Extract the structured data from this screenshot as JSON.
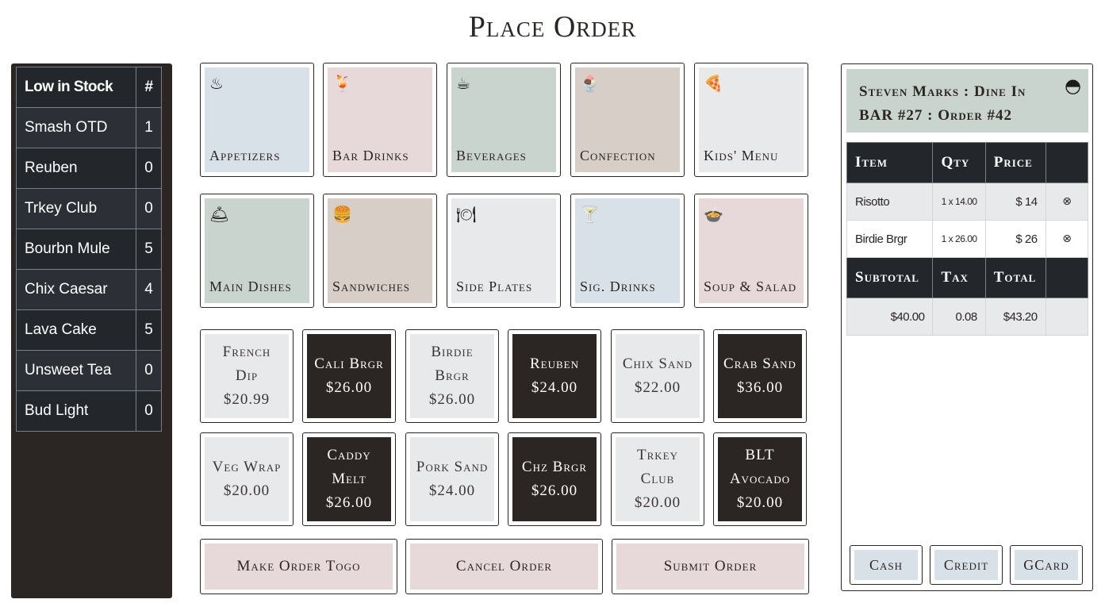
{
  "page": {
    "title": "Place Order"
  },
  "low_stock": {
    "header_name": "Low in Stock",
    "header_count": "#",
    "items": [
      {
        "name": "Smash OTD",
        "count": "1"
      },
      {
        "name": "Reuben",
        "count": "0"
      },
      {
        "name": "Trkey Club",
        "count": "0"
      },
      {
        "name": "Bourbn Mule",
        "count": "5"
      },
      {
        "name": "Chix Caesar",
        "count": "4"
      },
      {
        "name": "Lava Cake",
        "count": "5"
      },
      {
        "name": "Unsweet Tea",
        "count": "0"
      },
      {
        "name": "Bud Light",
        "count": "0"
      }
    ]
  },
  "categories": [
    {
      "label": "Appetizers",
      "icon": "chef-hat-icon",
      "glyph": "♨",
      "bg": "#d9e1e8"
    },
    {
      "label": "Bar Drinks",
      "icon": "cocktail-glass-icon",
      "glyph": "🍹",
      "bg": "#e7d9da"
    },
    {
      "label": "Beverages",
      "icon": "coffee-cup-icon",
      "glyph": "☕",
      "bg": "#c9d4cf"
    },
    {
      "label": "Confection",
      "icon": "sundae-icon",
      "glyph": "🍨",
      "bg": "#d7cec7"
    },
    {
      "label": "Kids' Menu",
      "icon": "pizza-slice-icon",
      "glyph": "🍕",
      "bg": "#e8e9eb"
    },
    {
      "label": "Main Dishes",
      "icon": "cloche-icon",
      "glyph": "🛎",
      "bg": "#c9d4cf"
    },
    {
      "label": "Sandwiches",
      "icon": "burger-icon",
      "glyph": "🍔",
      "bg": "#d7cec7"
    },
    {
      "label": "Side Plates",
      "icon": "plate-utensils-icon",
      "glyph": "🍽",
      "bg": "#e8e9eb"
    },
    {
      "label": "Sig. Drinks",
      "icon": "martini-icon",
      "glyph": "🍸",
      "bg": "#d9e1e8"
    },
    {
      "label": "Soup & Salad",
      "icon": "soup-bowl-icon",
      "glyph": "🍲",
      "bg": "#e7d9da"
    }
  ],
  "menu_items": [
    {
      "name": "French Dip",
      "price": "$20.99",
      "style": "light"
    },
    {
      "name": "Cali Brgr",
      "price": "$26.00",
      "style": "dark"
    },
    {
      "name": "Birdie Brgr",
      "price": "$26.00",
      "style": "light"
    },
    {
      "name": "Reuben",
      "price": "$24.00",
      "style": "dark"
    },
    {
      "name": "Chix Sand",
      "price": "$22.00",
      "style": "light"
    },
    {
      "name": "Crab Sand",
      "price": "$36.00",
      "style": "dark"
    },
    {
      "name": "Veg Wrap",
      "price": "$20.00",
      "style": "light"
    },
    {
      "name": "Caddy Melt",
      "price": "$26.00",
      "style": "dark"
    },
    {
      "name": "Pork Sand",
      "price": "$24.00",
      "style": "light"
    },
    {
      "name": "Chz Brgr",
      "price": "$26.00",
      "style": "dark"
    },
    {
      "name": "Trkey Club",
      "price": "$20.00",
      "style": "light"
    },
    {
      "name": "BLT Avocado",
      "price": "$20.00",
      "style": "dark"
    }
  ],
  "actions": {
    "togo": "Make Order Togo",
    "cancel": "Cancel Order",
    "submit": "Submit Order"
  },
  "order": {
    "customer_line": "Steven Marks : Dine In",
    "table_line": "BAR #27 : Order #42",
    "icon": "noodle-bowl-icon",
    "columns": {
      "item": "Item",
      "qty": "Qty",
      "price": "Price"
    },
    "lines": [
      {
        "item": "Risotto",
        "qty": "1 x 14.00",
        "price": "$ 14",
        "remove_glyph": "⊗"
      },
      {
        "item": "Birdie Brgr",
        "qty": "1 x 26.00",
        "price": "$ 26",
        "remove_glyph": "⊗"
      }
    ],
    "totals_columns": {
      "subtotal": "Subtotal",
      "tax": "Tax",
      "total": "Total"
    },
    "totals": {
      "subtotal": "$40.00",
      "tax": "0.08",
      "total": "$43.20"
    },
    "payment": {
      "cash": "Cash",
      "credit": "Credit",
      "gcard": "GCard"
    }
  },
  "colors": {
    "dark": "#2b2523",
    "table_header": "#23272c",
    "light_tile": "#e8e9eb",
    "rose": "#e7d9da",
    "sage": "#c9d4cf",
    "blue_gray": "#d9e1e8",
    "taupe": "#d7cec7"
  }
}
